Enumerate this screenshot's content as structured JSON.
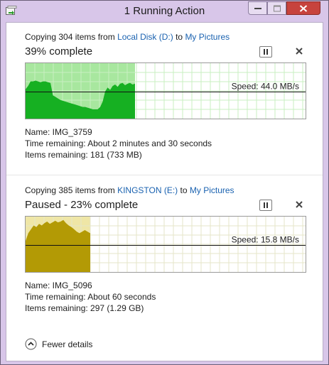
{
  "window": {
    "title": "1 Running Action",
    "colors": {
      "frame": "#d8c6e9",
      "close_button": "#c7433d",
      "link": "#1a62b0"
    }
  },
  "operations": [
    {
      "copy_prefix": "Copying 304 items from ",
      "source": "Local Disk (D:)",
      "to_text": " to ",
      "destination": "My Pictures",
      "status": "39% complete",
      "progress_fraction": 0.39,
      "speed_text": "Speed: 44.0 MB/s",
      "speed_level_fraction": 0.48,
      "paused": false,
      "colors": {
        "filled": "#a8e79f",
        "graph": "#16b022",
        "grid": "#c8efc2"
      },
      "name_text": "Name:  IMG_3759",
      "time_text": "Time remaining:  About 2 minutes and 30 seconds",
      "items_text": "Items remaining:  181 (733 MB)",
      "pause_icon": "pause-icon",
      "cancel_icon": "close-icon"
    },
    {
      "copy_prefix": "Copying 385 items from ",
      "source": "KINGSTON (E:)",
      "to_text": " to ",
      "destination": "My Pictures",
      "status": "Paused - 23% complete",
      "progress_fraction": 0.23,
      "speed_text": "Speed: 15.8 MB/s",
      "speed_level_fraction": 0.48,
      "paused": true,
      "colors": {
        "filled": "#efe6a6",
        "graph": "#b39a05",
        "grid": "#e6e6c8"
      },
      "name_text": "Name:  IMG_5096",
      "time_text": "Time remaining:  About 60 seconds",
      "items_text": "Items remaining:  297 (1.29 GB)",
      "pause_icon": "pause-icon",
      "cancel_icon": "close-icon"
    }
  ],
  "footer": {
    "label": "Fewer details",
    "icon": "chevron-up-icon"
  }
}
